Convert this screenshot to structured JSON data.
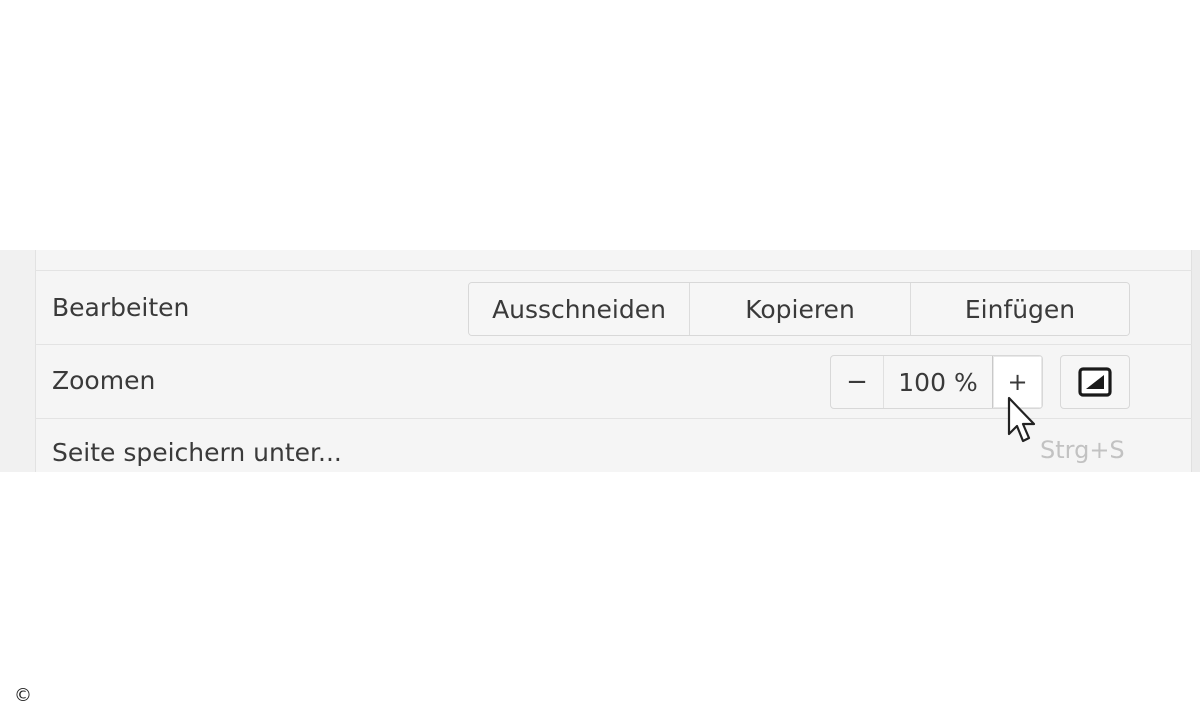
{
  "menu": {
    "edit": {
      "label": "Bearbeiten",
      "buttons": [
        "Ausschneiden",
        "Kopieren",
        "Einfügen"
      ]
    },
    "zoom": {
      "label": "Zoomen",
      "minus": "−",
      "value": "100 %",
      "plus": "+",
      "fullscreen_icon": "fullscreen-icon"
    },
    "save_page": {
      "label": "Seite speichern unter...",
      "shortcut": "Strg+S"
    }
  },
  "footer": {
    "copyright_symbol": "©"
  },
  "colors": {
    "menu_background": "#f5f5f5",
    "separator": "#e3e3e3",
    "text": "#3a3a3a",
    "shortcut_text": "#c2c2c2"
  },
  "icons": [
    "fullscreen-icon",
    "mouse-cursor-icon"
  ]
}
